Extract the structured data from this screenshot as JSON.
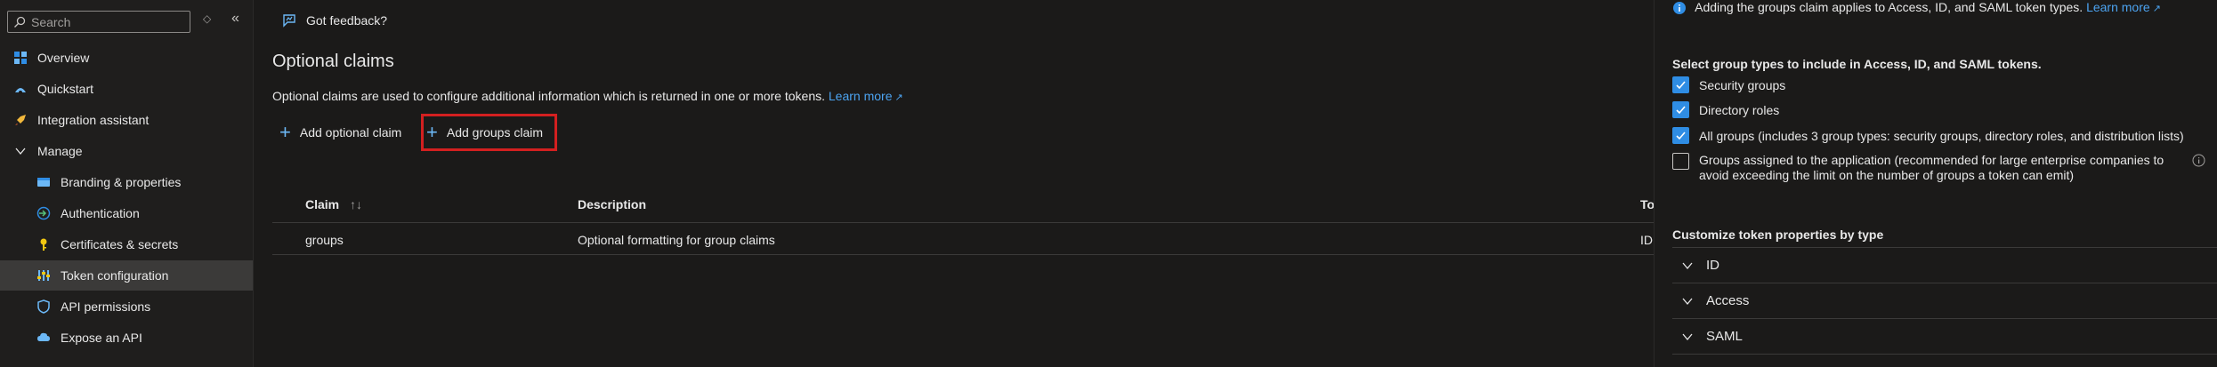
{
  "sidebar": {
    "search_placeholder": "Search",
    "items": [
      {
        "label": "Overview",
        "icon": "overview-icon"
      },
      {
        "label": "Quickstart",
        "icon": "quickstart-icon"
      },
      {
        "label": "Integration assistant",
        "icon": "rocket-icon"
      },
      {
        "label": "Manage",
        "icon": "chevron-down-icon"
      },
      {
        "label": "Branding & properties",
        "icon": "branding-icon"
      },
      {
        "label": "Authentication",
        "icon": "authentication-icon"
      },
      {
        "label": "Certificates & secrets",
        "icon": "key-icon"
      },
      {
        "label": "Token configuration",
        "icon": "token-config-icon"
      },
      {
        "label": "API permissions",
        "icon": "api-permissions-icon"
      },
      {
        "label": "Expose an API",
        "icon": "cloud-icon"
      }
    ]
  },
  "toolbar": {
    "feedback_label": "Got feedback?"
  },
  "main": {
    "title": "Optional claims",
    "description": "Optional claims are used to configure additional information which is returned in one or more tokens.",
    "learn_more": "Learn more",
    "add_optional_claim": "Add optional claim",
    "add_groups_claim": "Add groups claim",
    "table": {
      "headers": {
        "claim": "Claim",
        "description": "Description",
        "token_type_partial": "To"
      },
      "rows": [
        {
          "claim": "groups",
          "description": "Optional formatting for group claims",
          "token_type_partial": "ID"
        }
      ]
    }
  },
  "panel": {
    "info_text": "Adding the groups claim applies to Access, ID, and SAML token types.",
    "info_link": "Learn more",
    "select_heading": "Select group types to include in Access, ID, and SAML tokens.",
    "options": [
      {
        "label": "Security groups",
        "checked": true
      },
      {
        "label": "Directory roles",
        "checked": true
      },
      {
        "label": "All groups (includes 3 group types: security groups, directory roles, and distribution lists)",
        "checked": true
      },
      {
        "label_line1": "Groups assigned to the application (recommended for large enterprise companies to",
        "label_line2": "avoid exceeding the limit on the number of groups a token can emit)",
        "checked": false
      }
    ],
    "customize_heading": "Customize token properties by type",
    "sections": [
      "ID",
      "Access",
      "SAML"
    ]
  },
  "colors": {
    "accent": "#2f8de4",
    "link": "#4ca3f0",
    "highlight_border": "#d32020",
    "background": "#1b1a19"
  }
}
